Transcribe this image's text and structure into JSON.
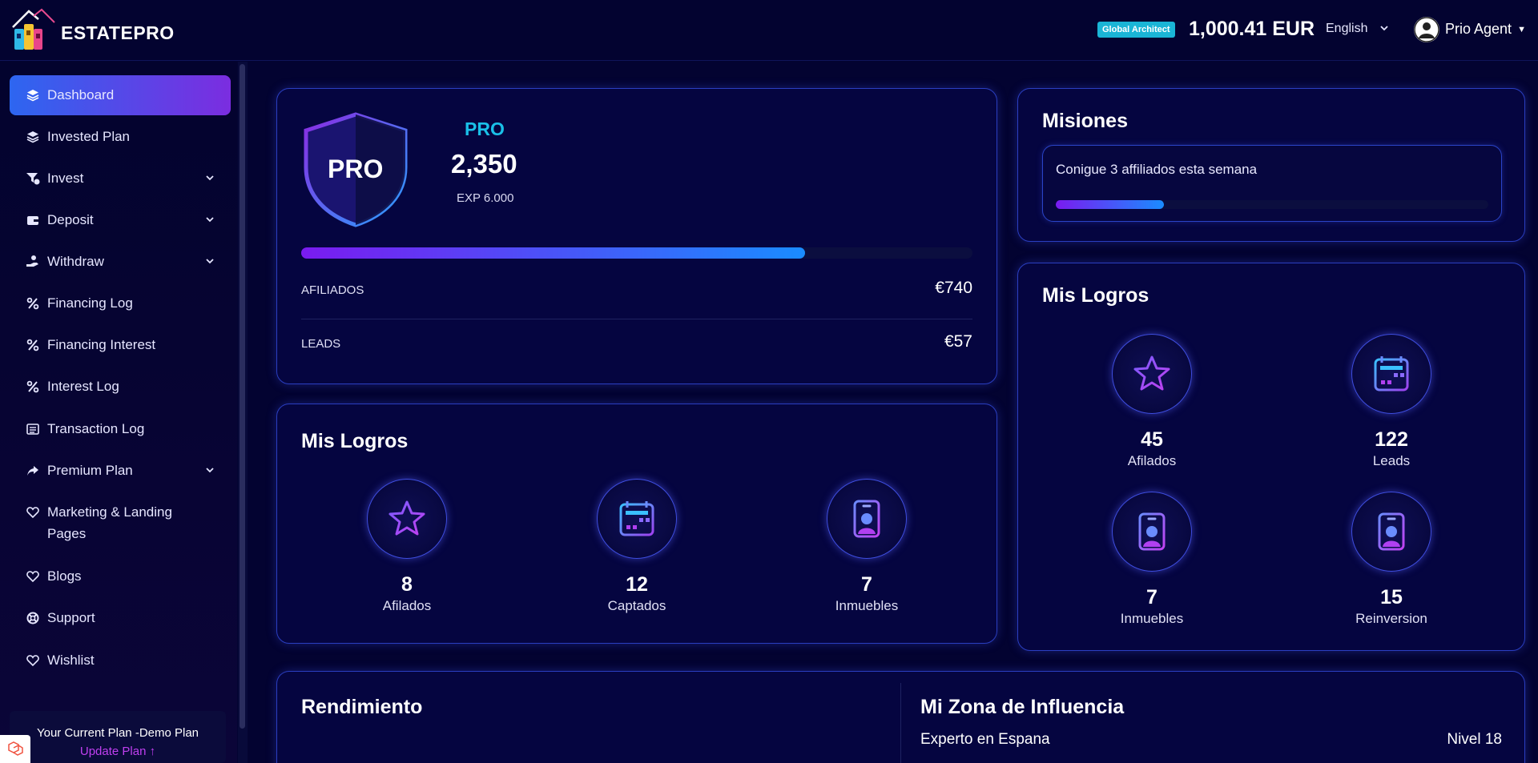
{
  "header": {
    "brand": "ESTATEPRO",
    "badge": "Global Architect",
    "balance": "1,000.41 EUR",
    "language": "English",
    "user_name": "Prio Agent"
  },
  "sidebar": {
    "items": [
      {
        "label": "Dashboard",
        "icon": "layers-icon",
        "active": true
      },
      {
        "label": "Invested Plan",
        "icon": "layers-icon"
      },
      {
        "label": "Invest",
        "icon": "funnel-icon",
        "has_submenu": true
      },
      {
        "label": "Deposit",
        "icon": "wallet-icon",
        "has_submenu": true
      },
      {
        "label": "Withdraw",
        "icon": "hand-coin-icon",
        "has_submenu": true
      },
      {
        "label": "Financing Log",
        "icon": "percent-icon"
      },
      {
        "label": "Financing Interest",
        "icon": "percent-icon"
      },
      {
        "label": "Interest Log",
        "icon": "percent-icon"
      },
      {
        "label": "Transaction Log",
        "icon": "list-icon"
      },
      {
        "label": "Premium Plan",
        "icon": "share-icon",
        "has_submenu": true
      },
      {
        "label": "Marketing & Landing Pages",
        "icon": "heart-icon"
      },
      {
        "label": "Blogs",
        "icon": "heart-icon"
      },
      {
        "label": "Support",
        "icon": "lifebuoy-icon"
      },
      {
        "label": "Wishlist",
        "icon": "heart-icon"
      }
    ],
    "plan": {
      "title": "Your Current Plan -Demo Plan",
      "update_label": "Update Plan"
    }
  },
  "level_card": {
    "shield_text": "PRO",
    "level_name": "PRO",
    "points": "2,350",
    "exp": "EXP 6.000",
    "progress": 0.75,
    "stats": [
      {
        "label": "AFILIADOS",
        "value": "€740"
      },
      {
        "label": "LEADS",
        "value": "€57"
      }
    ]
  },
  "achievements_main": {
    "title": "Mis Logros",
    "items": [
      {
        "value": "8",
        "label": "Afilados",
        "icon": "star-icon"
      },
      {
        "value": "12",
        "label": "Captados",
        "icon": "calendar-icon"
      },
      {
        "value": "7",
        "label": "Inmuebles",
        "icon": "badge-id-icon"
      }
    ]
  },
  "missions": {
    "title": "Misiones",
    "mission_text": "Conigue 3 affiliados esta semana",
    "progress": 0.25
  },
  "achievements_side": {
    "title": "Mis Logros",
    "items": [
      {
        "value": "45",
        "label": "Afilados",
        "icon": "star-icon"
      },
      {
        "value": "122",
        "label": "Leads",
        "icon": "calendar-icon"
      },
      {
        "value": "7",
        "label": "Inmuebles",
        "icon": "badge-id-icon"
      },
      {
        "value": "15",
        "label": "Reinversion",
        "icon": "badge-id-icon"
      }
    ]
  },
  "bottom": {
    "performance_title": "Rendimiento",
    "zone_title": "Mi Zona de Influencia",
    "zone_subtitle": "Experto en Espana",
    "zone_level": "Nivel 18"
  },
  "colors": {
    "background": "#030331",
    "accent_cyan": "#1ac0e8",
    "accent_purple": "#7a1bf0",
    "accent_blue": "#1a8cff",
    "card_border": "#2a3ec0"
  }
}
